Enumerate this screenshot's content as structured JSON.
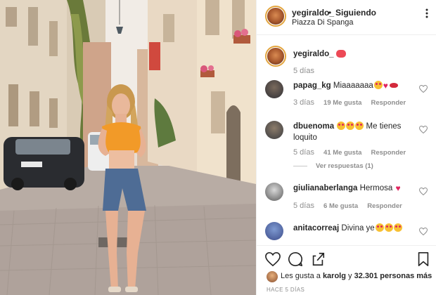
{
  "post": {
    "author": "yegiraldo_",
    "separator": "•",
    "follow_state": "Siguiendo",
    "location": "Piazza Di Spanga",
    "photo_icon": "street-photo"
  },
  "caption": {
    "username": "yegiraldo_",
    "time": "5 días"
  },
  "comments": [
    {
      "username": "papag_kg",
      "text": "Miaaaaaaa",
      "time": "3 días",
      "likes": "19 Me gusta",
      "reply": "Responder"
    },
    {
      "username": "dbuenoma",
      "text": "Me tienes loquito",
      "time": "5 días",
      "likes": "41 Me gusta",
      "reply": "Responder",
      "view_replies": "Ver respuestas (1)"
    },
    {
      "username": "giulianaberlanga",
      "text": "Hermosa",
      "time": "5 días",
      "likes": "6 Me gusta",
      "reply": "Responder"
    },
    {
      "username": "anitacorreaj",
      "text": "Divina ye"
    }
  ],
  "likes_summary": {
    "prefix": "Les gusta a",
    "user": "karolg",
    "connector": "y",
    "count_text": "32.301 personas más"
  },
  "posted_ago": "HACE 5 DÍAS",
  "colors": {
    "link_blue": "#003569",
    "heart_red": "#ed4956",
    "border": "#efefef",
    "muted": "#8e8e8e"
  }
}
